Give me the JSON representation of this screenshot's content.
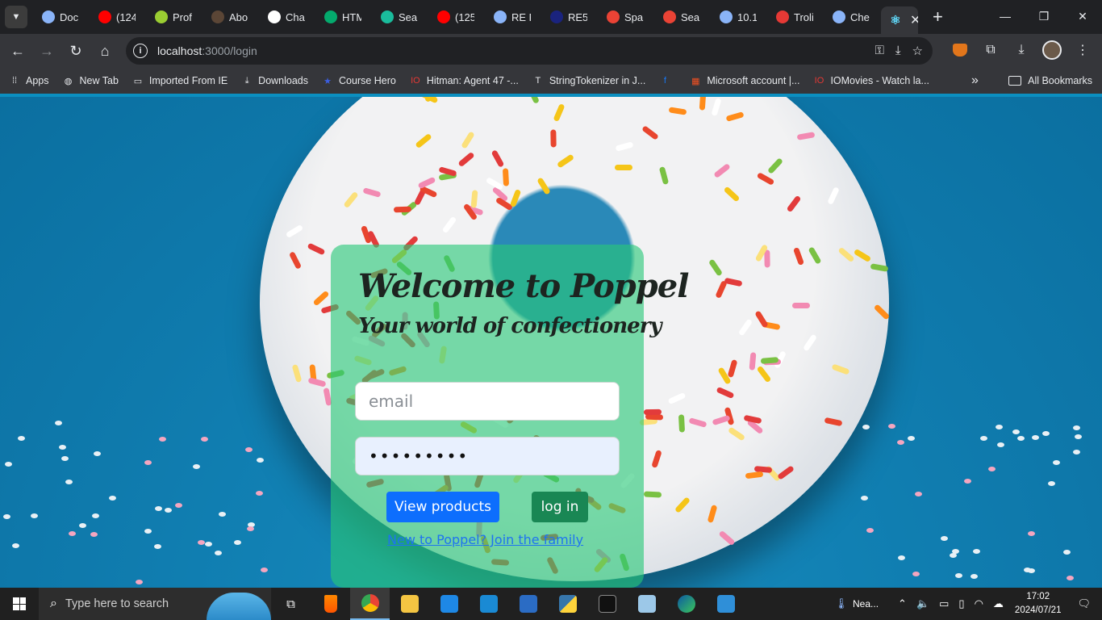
{
  "browser": {
    "tabs": [
      {
        "label": "Doc",
        "favicon_color": "#8ab4f8"
      },
      {
        "label": "(124",
        "favicon_color": "#ff0000"
      },
      {
        "label": "Prof",
        "favicon_color": "#9acd32"
      },
      {
        "label": "Abo",
        "favicon_color": "#5b4636"
      },
      {
        "label": "Cha",
        "favicon_color": "#ffffff"
      },
      {
        "label": "HTM",
        "favicon_color": "#04aa6d"
      },
      {
        "label": "Sear",
        "favicon_color": "#1abc9c"
      },
      {
        "label": "(125",
        "favicon_color": "#ff0000"
      },
      {
        "label": "RE F",
        "favicon_color": "#8ab4f8"
      },
      {
        "label": "RE5",
        "favicon_color": "#1a237e"
      },
      {
        "label": "Spa",
        "favicon_color": "#ea4335"
      },
      {
        "label": "Sear",
        "favicon_color": "#ea4335"
      },
      {
        "label": "10.1",
        "favicon_color": "#8ab4f8"
      },
      {
        "label": "Troli",
        "favicon_color": "#e53935"
      },
      {
        "label": "Che",
        "favicon_color": "#8ab4f8"
      }
    ],
    "active_tab_icon": "react-icon",
    "url_host": "localhost",
    "url_path": ":3000/login",
    "bookmarks": [
      {
        "label": "Apps",
        "icon": "apps-grid-icon"
      },
      {
        "label": "New Tab",
        "icon": "globe-icon"
      },
      {
        "label": "Imported From IE",
        "icon": "folder-icon"
      },
      {
        "label": "Downloads",
        "icon": "download-icon"
      },
      {
        "label": "Course Hero",
        "icon": "star-icon"
      },
      {
        "label": "Hitman: Agent 47 -...",
        "icon": "iomovies-icon"
      },
      {
        "label": "StringTokenizer in J...",
        "icon": "text-icon"
      },
      {
        "label": "",
        "icon": "facebook-icon"
      },
      {
        "label": "Microsoft account |...",
        "icon": "microsoft-icon"
      },
      {
        "label": "IOMovies - Watch la...",
        "icon": "iomovies-icon"
      }
    ],
    "all_bookmarks": "All Bookmarks"
  },
  "login": {
    "title": "Welcome to Poppel",
    "subtitle": "Your world of confectionery",
    "email_placeholder": "email",
    "password_value": "•••••••••",
    "view_products_label": "View products",
    "login_label": "log in",
    "join_link": "New to Poppel? Join the family"
  },
  "taskbar": {
    "search_placeholder": "Type here to search",
    "weather": "Nea...",
    "time": "17:02",
    "date": "2024/07/21"
  },
  "colors": {
    "card": "#28c878",
    "primary_button": "#0d6efd",
    "login_button": "#198754",
    "background": "#0b8fc0"
  }
}
